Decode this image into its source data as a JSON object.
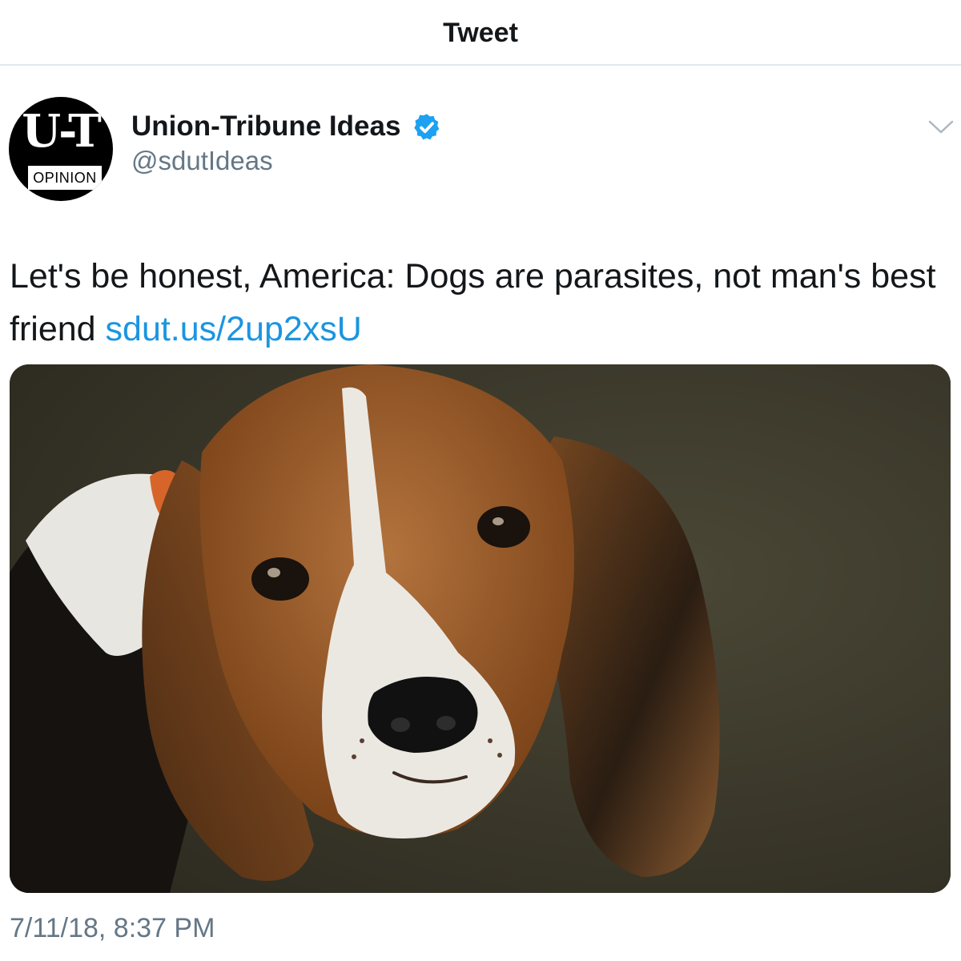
{
  "header": {
    "title": "Tweet"
  },
  "tweet": {
    "avatar": {
      "logo_text": "U-T",
      "badge_text": "OPINION"
    },
    "display_name": "Union-Tribune Ideas",
    "handle": "@sdutIdeas",
    "text": "Let's be honest, America: Dogs are parasites, not man's best friend",
    "link": "sdut.us/2up2xsU",
    "timestamp": "7/11/18, 8:37 PM",
    "icons": {
      "verified": "verified-badge-icon",
      "more": "chevron-down-icon"
    },
    "colors": {
      "link": "#1b95e0",
      "verified": "#1da1f2",
      "secondary_text": "#657786"
    }
  }
}
